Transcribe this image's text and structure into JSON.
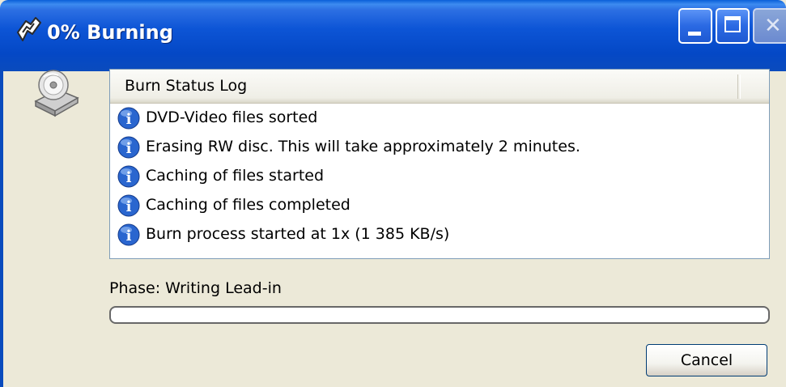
{
  "window": {
    "title": "0% Burning"
  },
  "log": {
    "column": "Burn Status Log",
    "entries": [
      {
        "icon": "info-icon",
        "text": "DVD-Video files sorted"
      },
      {
        "icon": "info-icon",
        "text": "Erasing RW disc. This will take approximately 2 minutes."
      },
      {
        "icon": "info-icon",
        "text": "Caching of files started"
      },
      {
        "icon": "info-icon",
        "text": "Caching of files completed"
      },
      {
        "icon": "info-icon",
        "text": "Burn process started at 1x (1 385 KB/s)"
      }
    ]
  },
  "status": {
    "phase": "Phase: Writing Lead-in",
    "progress_fraction": 0
  },
  "buttons": {
    "cancel": "Cancel"
  },
  "colors": {
    "titlebar": "#0a4bbd",
    "window_bg": "#ece9d8",
    "info_icon": "#1e5bc6"
  }
}
